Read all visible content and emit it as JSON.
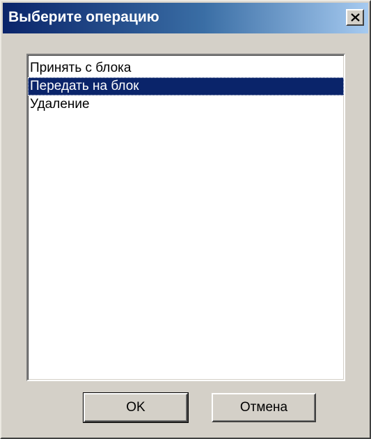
{
  "window": {
    "title": "Выберите операцию"
  },
  "list": {
    "items": [
      {
        "label": "Принять с блока",
        "selected": false
      },
      {
        "label": "Передать на блок",
        "selected": true
      },
      {
        "label": "Удаление",
        "selected": false
      }
    ]
  },
  "buttons": {
    "ok_label": "OK",
    "cancel_label": "Отмена"
  },
  "colors": {
    "title_gradient_start": "#0a246a",
    "title_gradient_end": "#a6caf0",
    "selection": "#0a246a",
    "face": "#d4d0c8"
  }
}
